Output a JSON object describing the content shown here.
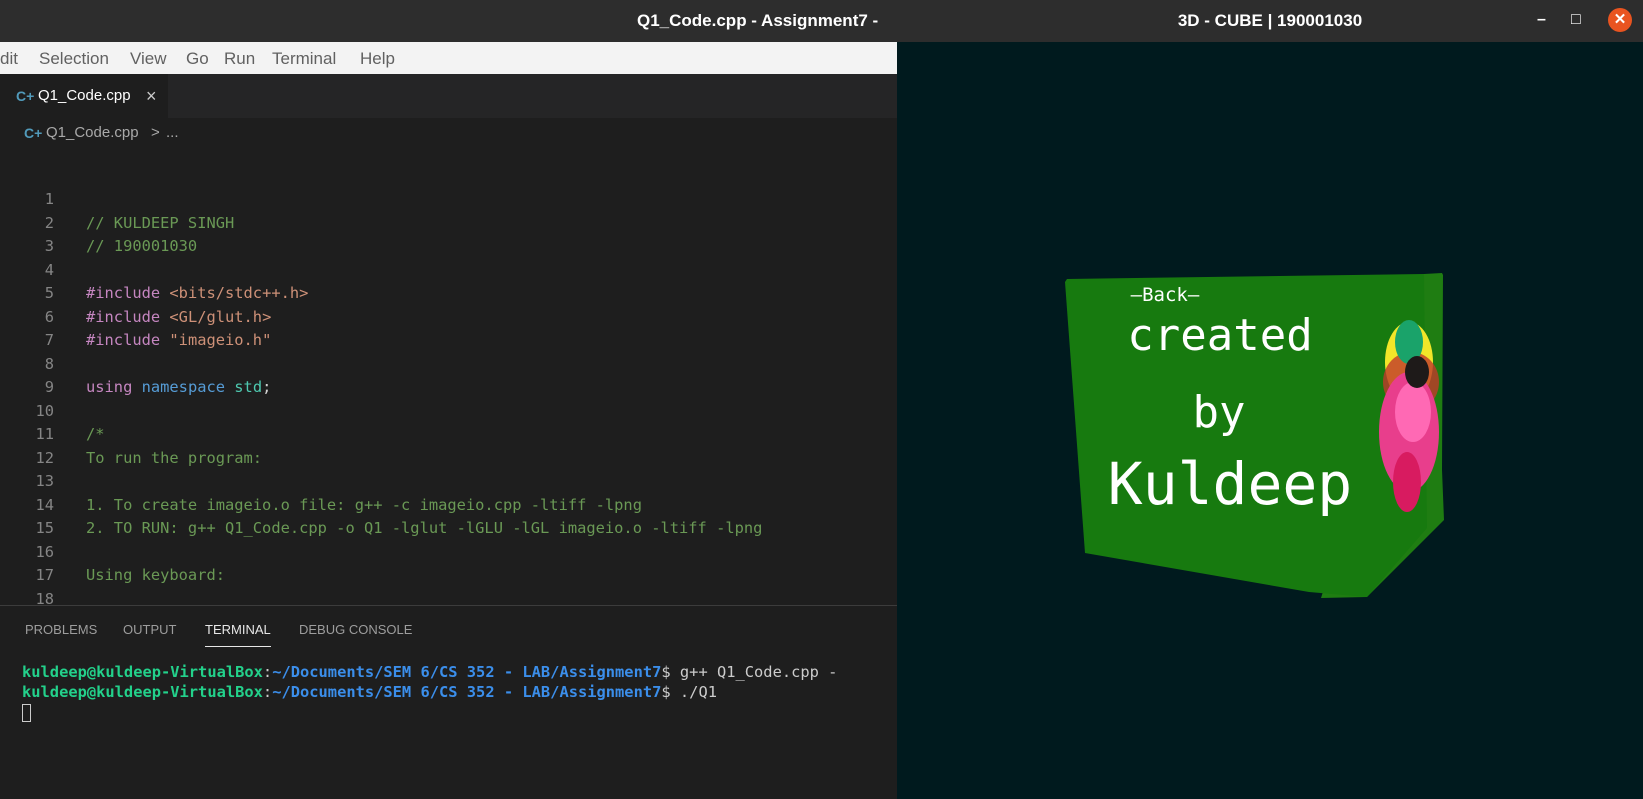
{
  "vscode": {
    "title": "Q1_Code.cpp - Assignment7 -",
    "menu": [
      "dit",
      "Selection",
      "View",
      "Go",
      "Run",
      "Terminal",
      "Help"
    ],
    "tab": {
      "icon": "cpp-file-icon",
      "label": "Q1_Code.cpp",
      "close": "×"
    },
    "breadcrumb": {
      "file": "Q1_Code.cpp",
      "separator": ">",
      "more": "..."
    },
    "editor": {
      "lines": [
        {
          "n": "1",
          "parts": []
        },
        {
          "n": "2",
          "parts": [
            {
              "t": "// KULDEEP SINGH",
              "c": "comment"
            }
          ]
        },
        {
          "n": "3",
          "parts": [
            {
              "t": "// 190001030",
              "c": "comment"
            }
          ]
        },
        {
          "n": "4",
          "parts": []
        },
        {
          "n": "5",
          "parts": [
            {
              "t": "#include ",
              "c": "pp"
            },
            {
              "t": "<bits/stdc++.h>",
              "c": "str"
            }
          ]
        },
        {
          "n": "6",
          "parts": [
            {
              "t": "#include ",
              "c": "pp"
            },
            {
              "t": "<GL/glut.h>",
              "c": "str"
            }
          ]
        },
        {
          "n": "7",
          "parts": [
            {
              "t": "#include ",
              "c": "pp"
            },
            {
              "t": "\"imageio.h\"",
              "c": "str"
            }
          ]
        },
        {
          "n": "8",
          "parts": []
        },
        {
          "n": "9",
          "parts": [
            {
              "t": "using ",
              "c": "pp"
            },
            {
              "t": "namespace ",
              "c": "kw"
            },
            {
              "t": "std",
              "c": "id"
            },
            {
              "t": ";",
              "c": "txt"
            }
          ]
        },
        {
          "n": "10",
          "parts": []
        },
        {
          "n": "11",
          "parts": [
            {
              "t": "/*",
              "c": "comment"
            }
          ]
        },
        {
          "n": "12",
          "parts": [
            {
              "t": "To run the program:",
              "c": "comment"
            }
          ]
        },
        {
          "n": "13",
          "parts": []
        },
        {
          "n": "14",
          "parts": [
            {
              "t": "1. To create imageio.o file: g++ -c imageio.cpp -ltiff -lpng",
              "c": "comment"
            }
          ]
        },
        {
          "n": "15",
          "parts": [
            {
              "t": "2. TO RUN: g++ Q1_Code.cpp -o Q1 -lglut -lGLU -lGL imageio.o -ltiff -lpng",
              "c": "comment"
            }
          ]
        },
        {
          "n": "16",
          "parts": []
        },
        {
          "n": "17",
          "parts": [
            {
              "t": "Using keyboard:",
              "c": "comment"
            }
          ]
        },
        {
          "n": "18",
          "parts": []
        }
      ]
    },
    "panel": {
      "tabs": [
        "PROBLEMS",
        "OUTPUT",
        "TERMINAL",
        "DEBUG CONSOLE"
      ],
      "active_tab": "TERMINAL",
      "terminal": [
        {
          "user": "kuldeep@kuldeep-VirtualBox",
          "path": "~/Documents/SEM 6/CS 352 - LAB/Assignment7",
          "cmd": "$ g++ Q1_Code.cpp -"
        },
        {
          "user": "kuldeep@kuldeep-VirtualBox",
          "path": "~/Documents/SEM 6/CS 352 - LAB/Assignment7",
          "cmd": "$ ./Q1"
        }
      ]
    }
  },
  "gl_window": {
    "title": "3D - CUBE | 190001030",
    "controls": {
      "minimize": "–",
      "maximize": "□",
      "close": "✕"
    },
    "cube": {
      "face_color": "#177a0f",
      "side_color": "#1f7d12",
      "text_back": "—Back—",
      "text_line1": "created",
      "text_line2": "by",
      "text_line3": "Kuldeep"
    },
    "background_color": "#001a1e"
  }
}
